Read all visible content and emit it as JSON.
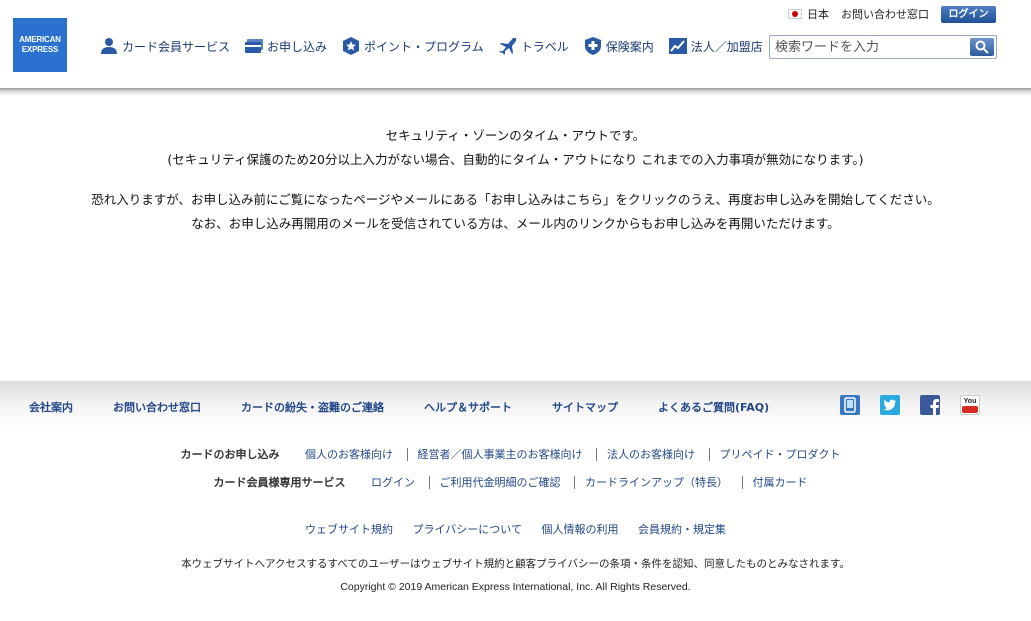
{
  "header": {
    "logo": {
      "line1": "AMERICAN",
      "line2": "EXPRESS"
    },
    "nav": [
      {
        "label": "カード会員サービス",
        "icon": "person-icon"
      },
      {
        "label": "お申し込み",
        "icon": "card-icon"
      },
      {
        "label": "ポイント・プログラム",
        "icon": "star-badge-icon"
      },
      {
        "label": "トラベル",
        "icon": "airplane-icon"
      },
      {
        "label": "保険案内",
        "icon": "shield-icon"
      },
      {
        "label": "法人／加盟店",
        "icon": "chart-icon"
      }
    ],
    "utility": {
      "country": "日本",
      "contact": "お問い合わせ窓口",
      "login": "ログイン"
    },
    "search": {
      "placeholder": "検索ワードを入力"
    }
  },
  "main": {
    "line1": "セキュリティ・ゾーンのタイム・アウトです。",
    "line2": "(セキュリティ保護のため20分以上入力がない場合、自動的にタイム・アウトになり これまでの入力事項が無効になります。)",
    "line3": "恐れ入りますが、お申し込み前にご覧になったページやメールにある「お申し込みはこちら」をクリックのうえ、再度お申し込みを開始してください。",
    "line4": "なお、お申し込み再開用のメールを受信されている方は、メール内のリンクからもお申し込みを再開いただけます。"
  },
  "footer": {
    "nav": [
      "会社案内",
      "お問い合わせ窓口",
      "カードの紛失・盗難のご連絡",
      "ヘルプ＆サポート",
      "サイトマップ",
      "よくあるご質問(FAQ)"
    ],
    "social": [
      {
        "icon": "mobile-icon",
        "color": "#3a78c4"
      },
      {
        "icon": "twitter-icon",
        "color": "#2aa9e0"
      },
      {
        "icon": "facebook-icon",
        "color": "#3b5998"
      },
      {
        "icon": "youtube-icon",
        "color": "#d42b22",
        "label": "You"
      }
    ],
    "apply": {
      "heading": "カードのお申し込み",
      "links": [
        "個人のお客様向け",
        "経営者／個人事業主のお客様向け",
        "法人のお客様向け",
        "プリペイド・プロダクト"
      ]
    },
    "member": {
      "heading": "カード会員様専用サービス",
      "links": [
        "ログイン",
        "ご利用代金明細のご確認",
        "カードラインアップ（特長）",
        "付属カード"
      ]
    },
    "legal": [
      "ウェブサイト規約",
      "プライバシーについて",
      "個人情報の利用",
      "会員規約・規定集"
    ],
    "disclaimer": "本ウェブサイトへアクセスするすべてのユーザーはウェブサイト規約と顧客プライバシーの条項・条件を認知、同意したものとみなされます。",
    "copyright": "Copyright © 2019 American Express International, Inc. All Rights Reserved."
  }
}
